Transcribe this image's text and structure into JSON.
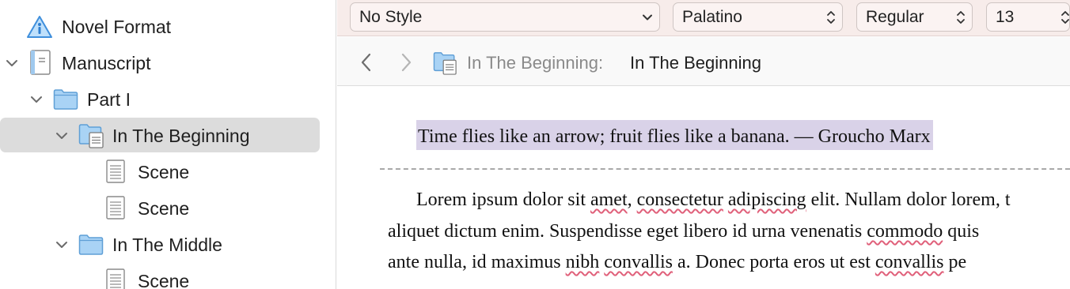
{
  "binder": {
    "items": [
      {
        "label": "Novel Format",
        "icon": "info-triangle-icon"
      },
      {
        "label": "Manuscript",
        "icon": "manuscript-icon"
      },
      {
        "label": "Part I",
        "icon": "folder-icon"
      },
      {
        "label": "In The Beginning",
        "icon": "folder-document-icon",
        "selected": true
      },
      {
        "label": "Scene",
        "icon": "document-icon"
      },
      {
        "label": "Scene",
        "icon": "document-icon"
      },
      {
        "label": "In The Middle",
        "icon": "folder-icon"
      },
      {
        "label": "Scene",
        "icon": "document-icon"
      }
    ]
  },
  "format_bar": {
    "style": "No Style",
    "font": "Palatino",
    "weight": "Regular",
    "size": "13"
  },
  "header": {
    "path": "In The Beginning:",
    "title": "In The Beginning"
  },
  "editor": {
    "epigraph": "Time flies like an arrow; fruit flies like a banana. — Groucho Marx",
    "line1": {
      "a": "Lorem ipsum dolor sit ",
      "s1": "amet",
      "b": ", ",
      "s2": "consectetur",
      "c": " ",
      "s3": "adipiscing",
      "d": " elit. Nullam dolor lorem, t"
    },
    "line2": {
      "a": "aliquet dictum enim. Suspendisse eget libero id urna venenatis ",
      "s1": "commodo",
      "b": " quis"
    },
    "line3": {
      "a": "ante nulla, id maximus ",
      "s1": "nibh",
      "b": " ",
      "s2": "convallis",
      "c": " a. Donec porta eros ut est ",
      "s3": "convallis",
      "d": " pe"
    }
  },
  "colors": {
    "selection_highlight": "#d9d2e8",
    "format_bar_bg": "#f7ecea",
    "binder_selected": "#dcdcdc",
    "folder_blue": "#a9d3f5",
    "spellcheck_underline": "#e0607a"
  }
}
